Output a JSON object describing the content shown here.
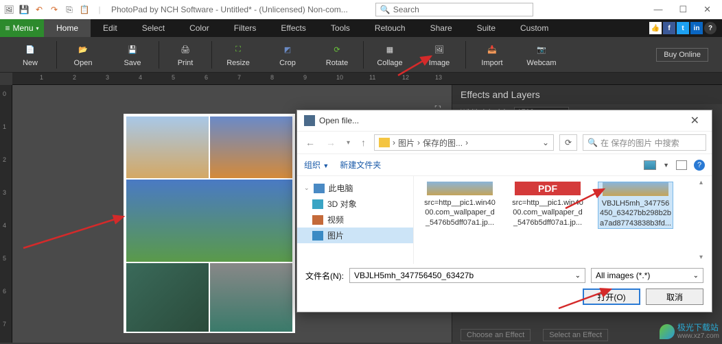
{
  "titlebar": {
    "app_title": "PhotoPad by NCH Software - Untitled* - (Unlicensed) Non-com...",
    "search_placeholder": "Search"
  },
  "menubar": {
    "menu_label": "Menu",
    "tabs": [
      "Home",
      "Edit",
      "Select",
      "Color",
      "Filters",
      "Effects",
      "Tools",
      "Retouch",
      "Share",
      "Suite",
      "Custom"
    ]
  },
  "toolbar": {
    "items": [
      "New",
      "Open",
      "Save",
      "Print",
      "Resize",
      "Crop",
      "Rotate",
      "Collage",
      "Image",
      "Import",
      "Webcam"
    ],
    "buy_label": "Buy Online"
  },
  "ruler_h": [
    "1",
    "2",
    "3",
    "4",
    "5",
    "6",
    "7",
    "8",
    "9",
    "10",
    "11",
    "12",
    "13"
  ],
  "ruler_v": [
    "0",
    "1",
    "2",
    "3",
    "4",
    "5",
    "6",
    "7"
  ],
  "right_panel": {
    "title": "Effects and Layers",
    "width_label": "Width (pixels):",
    "width_value": "1793",
    "choose_label": "Choose an Effect",
    "select_label": "Select an Effect"
  },
  "dialog": {
    "title": "Open file...",
    "breadcrumb_sep": "›",
    "breadcrumb": [
      "图片",
      "保存的图..."
    ],
    "search_placeholder": "在 保存的图片 中搜索",
    "organize": "组织",
    "new_folder": "新建文件夹",
    "sidebar": [
      {
        "label": "此电脑",
        "icon": "pc"
      },
      {
        "label": "3D 对象",
        "icon": "3d"
      },
      {
        "label": "视频",
        "icon": "video"
      },
      {
        "label": "图片",
        "icon": "pictures",
        "selected": true
      }
    ],
    "files": [
      {
        "name": "src=http__pic1.win4000.com_wallpaper_d_5476b5dff07a1.jp...",
        "thumb": "photo"
      },
      {
        "name": "src=http__pic1.win4000.com_wallpaper_d_5476b5dff07a1.jp...",
        "thumb": "pdf",
        "pdf_label": "PDF"
      },
      {
        "name": "VBJLH5mh_347756450_63427bb298b2ba7ad87743838b3fd...",
        "thumb": "photo",
        "selected": true
      }
    ],
    "filename_label": "文件名(N):",
    "filename_value": "VBJLH5mh_347756450_63427b",
    "filter": "All images (*.*)",
    "open_btn": "打开(O)",
    "cancel_btn": "取消"
  },
  "watermark": {
    "text": "极光下载站",
    "url": "www.xz7.com"
  }
}
